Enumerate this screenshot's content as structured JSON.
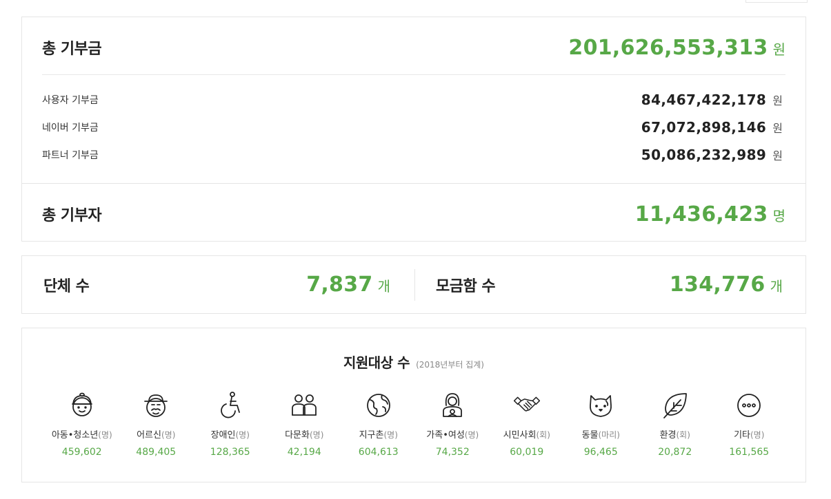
{
  "total_donation": {
    "label": "총 기부금",
    "value": "201,626,553,313",
    "unit": "원",
    "breakdown": [
      {
        "label": "사용자 기부금",
        "value": "84,467,422,178",
        "unit": "원"
      },
      {
        "label": "네이버 기부금",
        "value": "67,072,898,146",
        "unit": "원"
      },
      {
        "label": "파트너 기부금",
        "value": "50,086,232,989",
        "unit": "원"
      }
    ]
  },
  "total_donors": {
    "label": "총 기부자",
    "value": "11,436,423",
    "unit": "명"
  },
  "organizations": {
    "label": "단체 수",
    "value": "7,837",
    "unit": "개"
  },
  "fundraisers": {
    "label": "모금함 수",
    "value": "134,776",
    "unit": "개"
  },
  "support_targets": {
    "title": "지원대상 수",
    "note": "(2018년부터 집계)",
    "categories": [
      {
        "name": "아동•청소년",
        "unit": "(명)",
        "value": "459,602",
        "icon": "child-icon"
      },
      {
        "name": "어르신",
        "unit": "(명)",
        "value": "489,405",
        "icon": "elderly-icon"
      },
      {
        "name": "장애인",
        "unit": "(명)",
        "value": "128,365",
        "icon": "wheelchair-icon"
      },
      {
        "name": "다문화",
        "unit": "(명)",
        "value": "42,194",
        "icon": "multicultural-icon"
      },
      {
        "name": "지구촌",
        "unit": "(명)",
        "value": "604,613",
        "icon": "globe-icon"
      },
      {
        "name": "가족•여성",
        "unit": "(명)",
        "value": "74,352",
        "icon": "family-woman-icon"
      },
      {
        "name": "시민사회",
        "unit": "(회)",
        "value": "60,019",
        "icon": "handshake-icon"
      },
      {
        "name": "동물",
        "unit": "(마리)",
        "value": "96,465",
        "icon": "animal-icon"
      },
      {
        "name": "환경",
        "unit": "(회)",
        "value": "20,872",
        "icon": "leaf-icon"
      },
      {
        "name": "기타",
        "unit": "(명)",
        "value": "161,565",
        "icon": "more-icon"
      }
    ]
  }
}
